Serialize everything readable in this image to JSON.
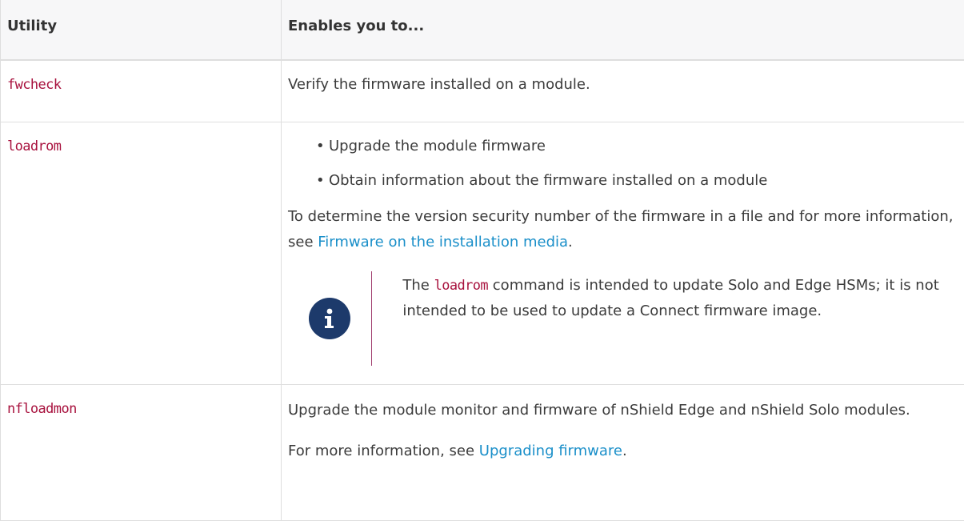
{
  "table": {
    "headers": [
      "Utility",
      "Enables you to..."
    ],
    "rows": [
      {
        "utility": "fwcheck",
        "description": "Verify the firmware installed on a module."
      },
      {
        "utility": "loadrom",
        "bullets": [
          "Upgrade the module firmware",
          "Obtain information about the firmware installed on a module"
        ],
        "para_before": "To determine the version security number of the firmware in a file and for more information, see ",
        "para_link": "Firmware on the installation media",
        "para_after": ".",
        "note": {
          "before": "The ",
          "code": "loadrom",
          "after": " command is intended to update Solo and Edge HSMs; it is not intended to be used to update a Connect firmware image.",
          "icon": "info-icon"
        }
      },
      {
        "utility": "nfloadmon",
        "description": "Upgrade the module monitor and firmware of nShield Edge and nShield Solo modules.",
        "para_before": "For more information, see ",
        "para_link": "Upgrading firmware",
        "para_after": "."
      }
    ]
  },
  "colors": {
    "code": "#a8123e",
    "link": "#1a8fc9",
    "icon": "#1d3a6b",
    "note_bar": "#a03e6e"
  }
}
